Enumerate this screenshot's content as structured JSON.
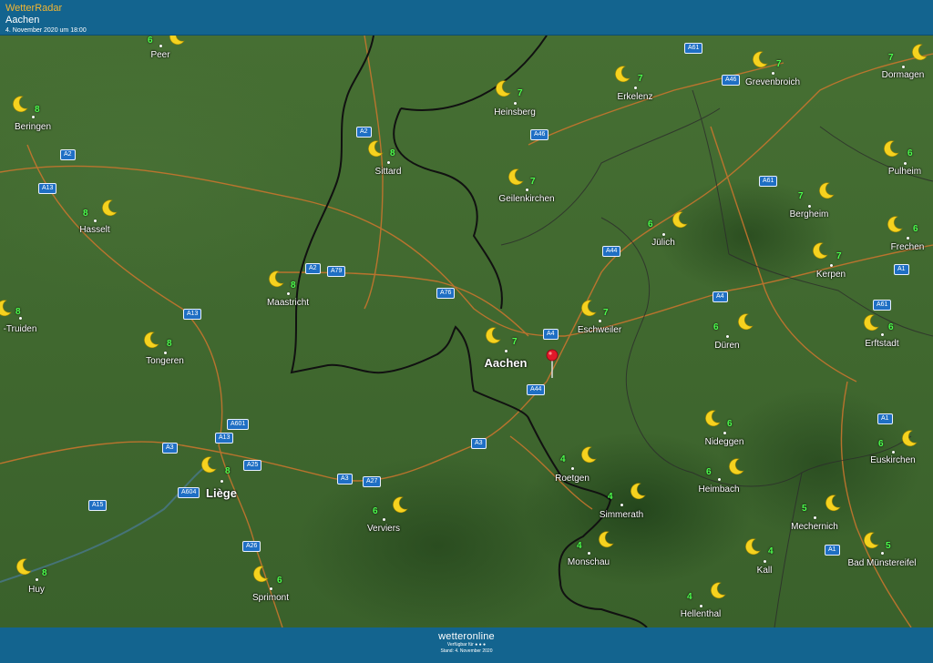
{
  "header": {
    "app_title": "WetterRadar",
    "location": "Aachen",
    "timestamp": "4. November 2020 um 18:00"
  },
  "footer": {
    "logo": "wetteronline",
    "available_for": "Verfügbar für ● ● ●",
    "start": "Stand: 4. November 2020"
  },
  "weather_icon": "crescent-moon-icon",
  "colors": {
    "bar": "#13648f",
    "temp": "#4cff4c",
    "moon": "#f5d21f",
    "road_badge": "#1f6fc4",
    "border": "#111111"
  },
  "cities": [
    {
      "name": "Peer",
      "temp": "6"
    },
    {
      "name": "Beringen",
      "temp": "8"
    },
    {
      "name": "Hasselt",
      "temp": "8"
    },
    {
      "name": "-Truiden",
      "temp": "8"
    },
    {
      "name": "Tongeren",
      "temp": "8"
    },
    {
      "name": "Maastricht",
      "temp": "8"
    },
    {
      "name": "Sittard",
      "temp": "8"
    },
    {
      "name": "Heinsberg",
      "temp": "7"
    },
    {
      "name": "Erkelenz",
      "temp": "7"
    },
    {
      "name": "Grevenbroich",
      "temp": "7"
    },
    {
      "name": "Dormagen",
      "temp": "7"
    },
    {
      "name": "Geilenkirchen",
      "temp": "7"
    },
    {
      "name": "Pulheim",
      "temp": "6"
    },
    {
      "name": "Bergheim",
      "temp": "7"
    },
    {
      "name": "Jülich",
      "temp": "6"
    },
    {
      "name": "Frechen",
      "temp": "6"
    },
    {
      "name": "Kerpen",
      "temp": "7"
    },
    {
      "name": "Eschweiler",
      "temp": "7"
    },
    {
      "name": "Aachen",
      "temp": "7"
    },
    {
      "name": "Düren",
      "temp": "6"
    },
    {
      "name": "Erftstadt",
      "temp": "6"
    },
    {
      "name": "Liège",
      "temp": "8"
    },
    {
      "name": "Nideggen",
      "temp": "6"
    },
    {
      "name": "Euskirchen",
      "temp": "6"
    },
    {
      "name": "Roetgen",
      "temp": "4"
    },
    {
      "name": "Heimbach",
      "temp": "6"
    },
    {
      "name": "Verviers",
      "temp": "6"
    },
    {
      "name": "Simmerath",
      "temp": "4"
    },
    {
      "name": "Mechernich",
      "temp": "5"
    },
    {
      "name": "Monschau",
      "temp": "4"
    },
    {
      "name": "Kall",
      "temp": "4"
    },
    {
      "name": "Bad Münstereifel",
      "temp": "5"
    },
    {
      "name": "Huy",
      "temp": "8"
    },
    {
      "name": "Sprimont",
      "temp": "6"
    },
    {
      "name": "Hellenthal",
      "temp": "4"
    }
  ],
  "roads": [
    "A61",
    "A46",
    "A2",
    "A46",
    "A2",
    "A13",
    "A61",
    "A2",
    "A79",
    "A76",
    "A44",
    "A13",
    "A4",
    "A4",
    "A61",
    "A44",
    "A601",
    "A13",
    "A3",
    "A3",
    "A25",
    "A3",
    "A27",
    "A604",
    "A15",
    "A26",
    "A1",
    "A1",
    "A1"
  ]
}
